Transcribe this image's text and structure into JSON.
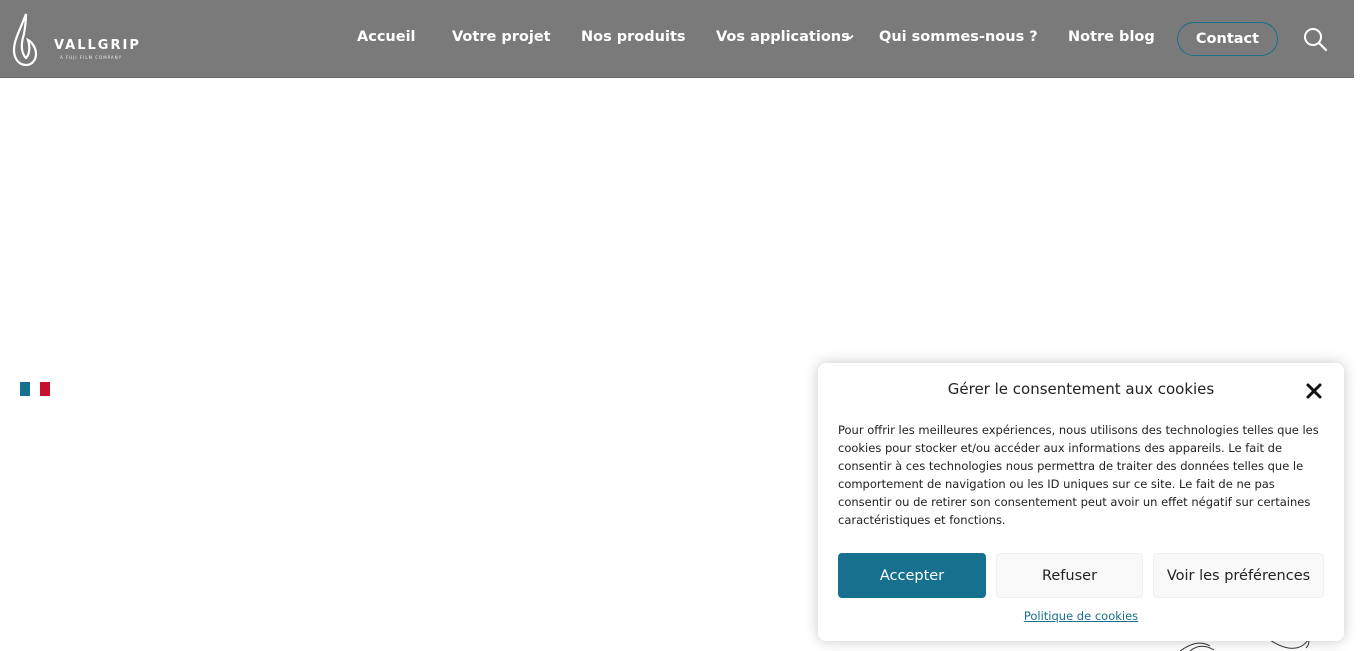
{
  "header": {
    "logo_text": "VALLGRIP",
    "logo_subtext": "A FUJI FILM COMPANY",
    "nav": {
      "home": "Accueil",
      "project": "Votre projet",
      "products": "Nos produits",
      "applications": "Vos applications",
      "about": "Qui sommes-nous ?",
      "blog": "Notre blog"
    },
    "contact_label": "Contact"
  },
  "colors": {
    "header_bg": "#7a7a7a",
    "accent": "#17708d",
    "flag_blue": "#17708d",
    "flag_red": "#c8102e"
  },
  "cookie": {
    "title": "Gérer le consentement aux cookies",
    "text": "Pour offrir les meilleures expériences, nous utilisons des technologies telles que les cookies pour stocker et/ou accéder aux informations des appareils. Le fait de consentir à ces technologies nous permettra de traiter des données telles que le comportement de navigation ou les ID uniques sur ce site. Le fait de ne pas consentir ou de retirer son consentement peut avoir un effet négatif sur certaines caractéristiques et fonctions.",
    "accept_label": "Accepter",
    "refuse_label": "Refuser",
    "prefs_label": "Voir les préférences",
    "policy_link": "Politique de cookies"
  }
}
